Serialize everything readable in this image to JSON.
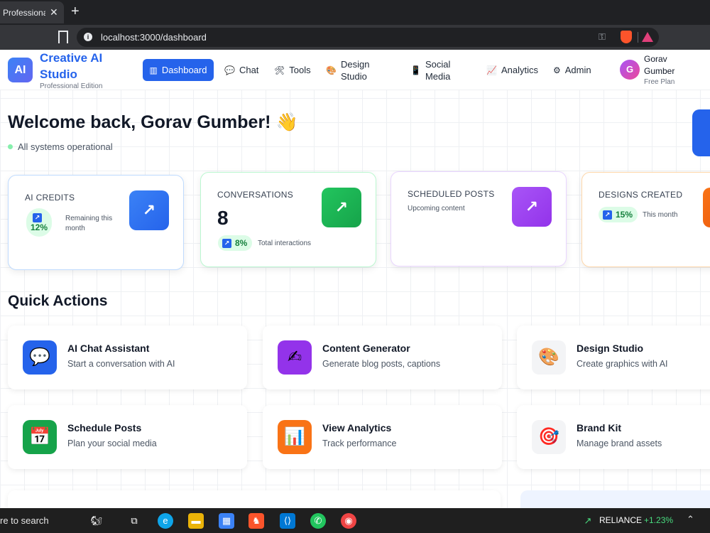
{
  "browser": {
    "tab_title": "Professional",
    "tab_close": "✕",
    "new_tab": "+",
    "url": "localhost:3000/dashboard"
  },
  "brand": {
    "logo": "AI",
    "title": "Creative AI Studio",
    "subtitle": "Professional Edition"
  },
  "nav": {
    "items": [
      {
        "label": "Dashboard",
        "icon": "bar-chart-icon",
        "glyph": "▥"
      },
      {
        "label": "Chat",
        "icon": "chat-bubble-icon",
        "glyph": "💬"
      },
      {
        "label": "Tools",
        "icon": "tools-icon",
        "glyph": "🛠"
      },
      {
        "label": "Design Studio",
        "icon": "palette-icon",
        "glyph": "🎨"
      },
      {
        "label": "Social Media",
        "icon": "phone-icon",
        "glyph": "📱"
      },
      {
        "label": "Analytics",
        "icon": "chart-icon",
        "glyph": "📈"
      },
      {
        "label": "Admin",
        "icon": "gear-icon",
        "glyph": "⚙"
      }
    ]
  },
  "user": {
    "initial": "G",
    "name": "Gorav Gumber",
    "plan": "Free Plan"
  },
  "welcome": {
    "heading": "Welcome back, Gorav Gumber! 👋",
    "status": "All systems operational"
  },
  "stats": [
    {
      "label": "AI CREDITS",
      "value": "",
      "pill": "12%",
      "note": "Remaining this month",
      "color": "#3b82f6",
      "border": "#bfdbfe"
    },
    {
      "label": "CONVERSATIONS",
      "value": "8",
      "pill": "8%",
      "note": "Total interactions",
      "color": "#22c55e",
      "border": "#bbf7d0"
    },
    {
      "label": "SCHEDULED POSTS",
      "value": "",
      "pill": "",
      "note": "Upcoming content",
      "color": "#a855f7",
      "border": "#e9d5ff"
    },
    {
      "label": "DESIGNS CREATED",
      "value": "",
      "pill": "15%",
      "note": "This month",
      "color": "#f97316",
      "border": "#fed7aa"
    }
  ],
  "quick_actions": {
    "title": "Quick Actions",
    "items": [
      {
        "title": "AI Chat Assistant",
        "desc": "Start a conversation with AI",
        "icon": "chat-icon",
        "glyph": "💬",
        "bg": "#2563eb"
      },
      {
        "title": "Content Generator",
        "desc": "Generate blog posts, captions",
        "icon": "pencil-icon",
        "glyph": "✍",
        "bg": "#9333ea"
      },
      {
        "title": "Design Studio",
        "desc": "Create graphics with AI",
        "icon": "palette-icon",
        "glyph": "🎨",
        "bg": "#f3f4f6"
      },
      {
        "title": "Schedule Posts",
        "desc": "Plan your social media",
        "icon": "calendar-icon",
        "glyph": "📅",
        "bg": "#16a34a"
      },
      {
        "title": "View Analytics",
        "desc": "Track performance",
        "icon": "bar-chart-icon",
        "glyph": "📊",
        "bg": "#f97316"
      },
      {
        "title": "Brand Kit",
        "desc": "Manage brand assets",
        "icon": "target-icon",
        "glyph": "🎯",
        "bg": "#f3f4f6"
      }
    ]
  },
  "taskbar": {
    "search": "re to search",
    "ticker": "RELIANCE",
    "change": "+1.23%"
  }
}
